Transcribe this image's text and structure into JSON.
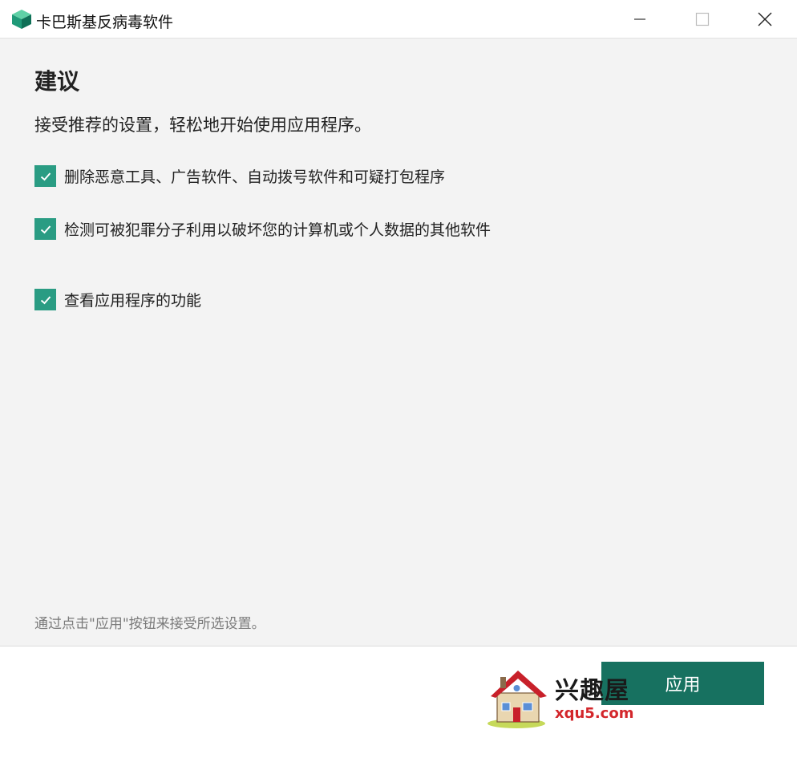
{
  "window": {
    "title": "卡巴斯基反病毒软件",
    "app_icon": "kaspersky-cube-icon",
    "controls": [
      "minimize-icon",
      "maximize-icon",
      "close-icon"
    ]
  },
  "page": {
    "heading": "建议",
    "subtitle": "接受推荐的设置，轻松地开始使用应用程序。",
    "options": [
      {
        "label": "删除恶意工具、广告软件、自动拨号软件和可疑打包程序",
        "checked": true
      },
      {
        "label": "检测可被犯罪分子利用以破坏您的计算机或个人数据的其他软件",
        "checked": true
      },
      {
        "label": "查看应用程序的功能",
        "checked": true
      }
    ],
    "hint": "通过点击\"应用\"按钮来接受所选设置。"
  },
  "actions": {
    "apply_label": "应用"
  },
  "watermark": {
    "name": "兴趣屋",
    "url": "xqu5.com"
  },
  "colors": {
    "checkbox": "#2a9c83",
    "apply_button": "#177160",
    "content_bg": "#f3f3f3"
  }
}
